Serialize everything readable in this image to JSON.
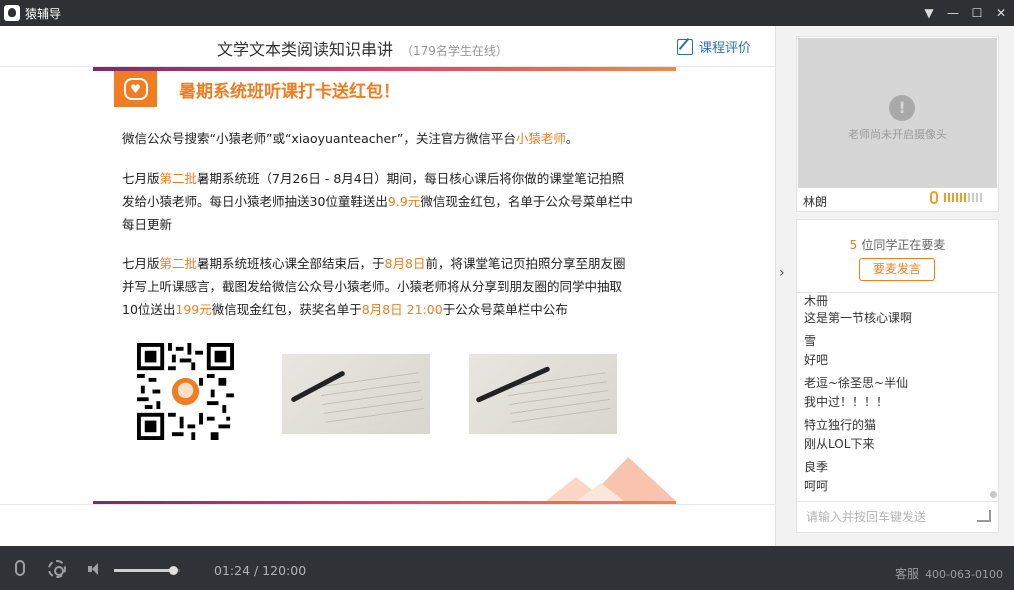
{
  "app": {
    "title": "猿辅导"
  },
  "window_controls": {
    "menu": "▼",
    "minimize": "—",
    "maximize": "☐",
    "close": "✕"
  },
  "course": {
    "title": "文学文本类阅读知识串讲",
    "online": "（179名学生在线）",
    "evaluate": "课程评价"
  },
  "slide": {
    "badge_icon": "♥",
    "headline": "暑期系统班听课打卡送红包！",
    "p1": {
      "a": "微信公众号搜索“小猿老师”或“xiaoyuanteacher”，关注官方微信平台",
      "b": "小猿老师",
      "c": "。"
    },
    "p2": {
      "a": "七月版",
      "b": "第二批",
      "c": "暑期系统班（7月26日 - 8月4日）期间，每日核心课后将你做的课堂笔记拍照",
      "d": "发给小猿老师。每日小猿老师抽送30位童鞋送出",
      "e": "9.9元",
      "f": "微信现金红包，名单于公众号菜单栏中",
      "g": "每日更新"
    },
    "p3": {
      "a": "七月版",
      "b": "第二批",
      "c": "暑期系统班核心课全部结束后，于",
      "d": "8月8日",
      "e": "前，将课堂笔记页拍照分享至朋友圈",
      "f": "并写上听课感言，截图发给微信公众号小猿老师。小猿老师将从分享到朋友圈的同学中抽取",
      "g": "10位送出",
      "h": "199元",
      "i": "微信现金红包，获奖名单于",
      "j": "8月8日 21:00",
      "k": "于公众号菜单栏中公布"
    }
  },
  "camera": {
    "message": "老师尚未开启摄像头",
    "warn_icon": "!",
    "teacher": "林朗",
    "mic_level": 0.6
  },
  "mic_queue": {
    "count": "5",
    "text": "位同学正在要麦",
    "button": "要麦发言"
  },
  "chat": [
    {
      "text": "木冊"
    },
    {
      "text": "这是第一节核心课啊"
    },
    {
      "text": "雪"
    },
    {
      "text": "好吧"
    },
    {
      "text": "老逗~徐圣思~半仙"
    },
    {
      "text": "我中过！！！！"
    },
    {
      "text": "特立独行的猫"
    },
    {
      "text": "刚从LOL下来"
    },
    {
      "text": "良季"
    },
    {
      "text": "呵呵"
    }
  ],
  "chat_input": {
    "placeholder": "请输入并按回车键发送"
  },
  "player": {
    "time": "01:24 / 120:00",
    "volume": 0.9,
    "support_label": "客服",
    "support_phone": "400-063-0100"
  },
  "colors": {
    "accent": "#f07d22",
    "link": "#2f6fb0",
    "dark_bar": "#2f3237"
  }
}
